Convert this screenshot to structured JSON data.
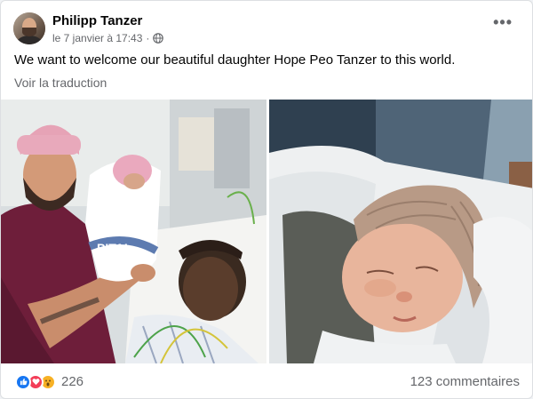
{
  "post": {
    "author": "Philipp Tanzer",
    "timestamp": "le 7 janvier à 17:43",
    "separator": "·",
    "privacy_icon": "globe-icon",
    "more_label": "•••",
    "text": "We want to welcome our beautiful daughter Hope Peo Tanzer to this world.",
    "translate_label": "Voir la traduction"
  },
  "photos": [
    {
      "name": "photo-family-hospital",
      "blanket_text": "PITAL"
    },
    {
      "name": "photo-newborn-knit-hat"
    }
  ],
  "footer": {
    "reaction_icons": [
      "like-icon",
      "love-icon",
      "wow-icon"
    ],
    "reactions_count": "226",
    "comments_label": "123 commentaires"
  },
  "colors": {
    "brand_blue": "#1877f2",
    "love_red": "#f33e58",
    "wow_yellow": "#f7b125",
    "secondary_text": "#65676b"
  }
}
